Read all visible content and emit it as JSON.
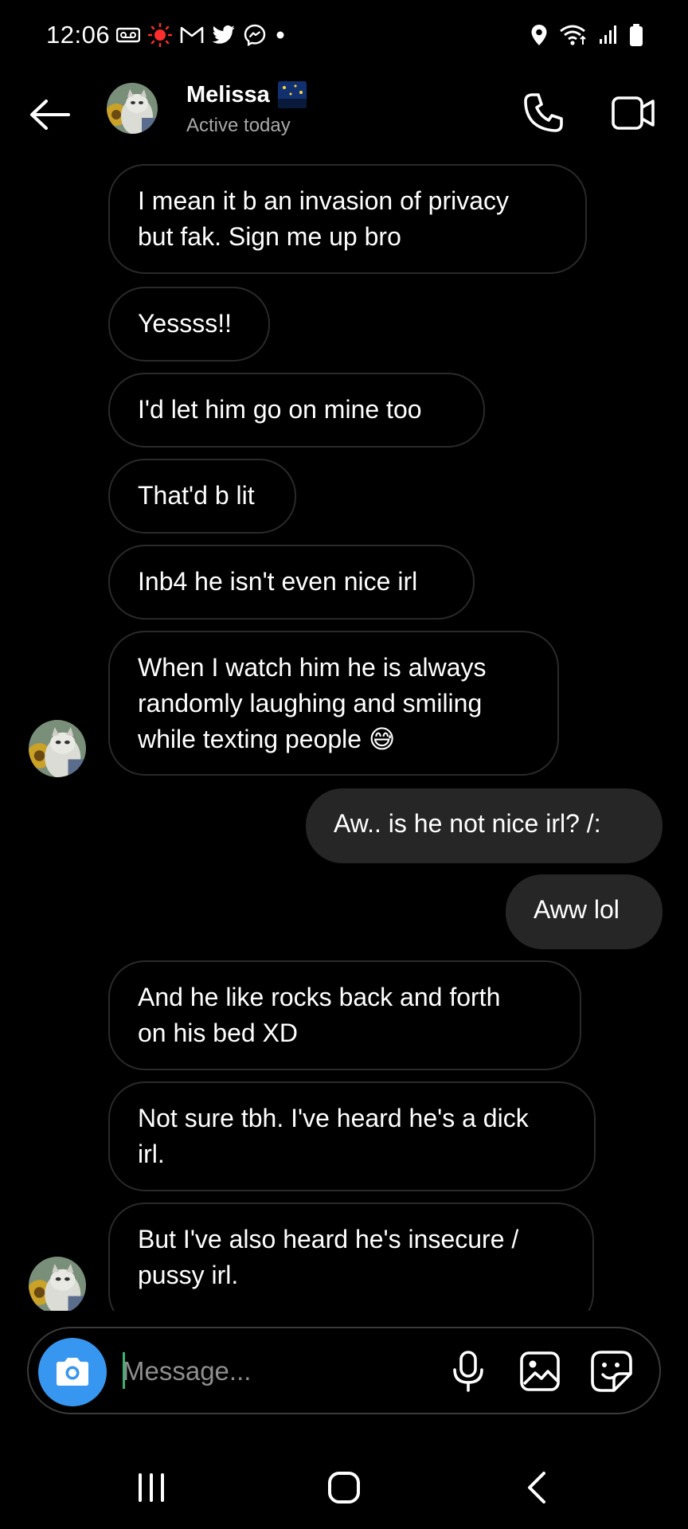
{
  "status_bar": {
    "time": "12:06",
    "left_icons": [
      "voicemail-icon",
      "notification-dot-icon",
      "gmail-icon",
      "twitter-icon",
      "messenger-icon",
      "more-dot-icon"
    ],
    "right_icons": [
      "location-icon",
      "wifi-icon",
      "signal-icon",
      "battery-icon"
    ]
  },
  "header": {
    "contact_name": "Melissa",
    "contact_status": "Active today",
    "icons": {
      "back": "arrow-left-icon",
      "call": "phone-icon",
      "video": "video-camera-icon"
    }
  },
  "messages": [
    {
      "direction": "in",
      "text_lines": [
        "I mean it b an invasion of privacy",
        "but fak. Sign me up bro"
      ]
    },
    {
      "direction": "in",
      "text_lines": [
        "Yessss!!"
      ]
    },
    {
      "direction": "in",
      "text_lines": [
        "I'd let him go on mine too"
      ]
    },
    {
      "direction": "in",
      "text_lines": [
        "That'd b lit"
      ]
    },
    {
      "direction": "in",
      "text_lines": [
        "Inb4 he isn't even nice irl"
      ]
    },
    {
      "direction": "in",
      "text_lines": [
        "When I watch him he is always",
        "randomly laughing and smiling",
        "while texting people 😅"
      ]
    },
    {
      "direction": "out",
      "text_lines": [
        "Aw.. is he not nice irl? /:"
      ]
    },
    {
      "direction": "out",
      "text_lines": [
        "Aww lol"
      ]
    },
    {
      "direction": "in",
      "text_lines": [
        "And he like rocks back and forth",
        "on his bed XD"
      ]
    },
    {
      "direction": "in",
      "text_lines": [
        "Not sure tbh. I've heard he's a dick",
        "irl."
      ]
    },
    {
      "direction": "in",
      "text_lines": [
        "But I've also heard he's insecure /",
        "pussy irl."
      ]
    }
  ],
  "composer": {
    "placeholder": "Message...",
    "icons": {
      "camera": "camera-icon",
      "mic": "microphone-icon",
      "gallery": "image-gallery-icon",
      "sticker": "sticker-icon"
    },
    "camera_color": "#3797f0"
  },
  "navbar": {
    "icons": [
      "recent-apps-icon",
      "home-icon",
      "back-icon"
    ]
  },
  "colors": {
    "background": "#000000",
    "outgoing_bubble": "#262626",
    "incoming_border": "#2a2a2a",
    "secondary_text": "#a8a8a8"
  }
}
